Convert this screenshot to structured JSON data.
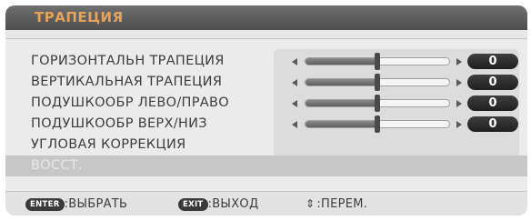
{
  "menu": {
    "title": "ТРАПЕЦИЯ",
    "items": [
      {
        "label": "ГОРИЗОНТАЛЬН ТРАПЕЦИЯ",
        "has_slider": true,
        "value": "0",
        "level": 0.5
      },
      {
        "label": "ВЕРТИКАЛЬНАЯ ТРАПЕЦИЯ",
        "has_slider": true,
        "value": "0",
        "level": 0.5
      },
      {
        "label": "ПОДУШКООБР ЛЕВО/ПРАВО",
        "has_slider": true,
        "value": "0",
        "level": 0.5
      },
      {
        "label": "ПОДУШКООБР ВЕРХ/НИЗ",
        "has_slider": true,
        "value": "0",
        "level": 0.5
      },
      {
        "label": "УГЛОВАЯ КОРРЕКЦИЯ",
        "has_slider": false
      },
      {
        "label": "ВОССТ.",
        "has_slider": false,
        "selected": true
      }
    ]
  },
  "footer": {
    "enter_key": "ENTER",
    "enter_label": ":ВЫБРАТЬ",
    "exit_key": "EXIT",
    "exit_label": ":ВЫХОД",
    "move_icon": "⇕",
    "move_label": ":ПЕРЕМ."
  },
  "colors": {
    "title_text": "#e2a35a",
    "selected_text": "#e6e6e6",
    "menu_text": "#3d3d3d"
  }
}
